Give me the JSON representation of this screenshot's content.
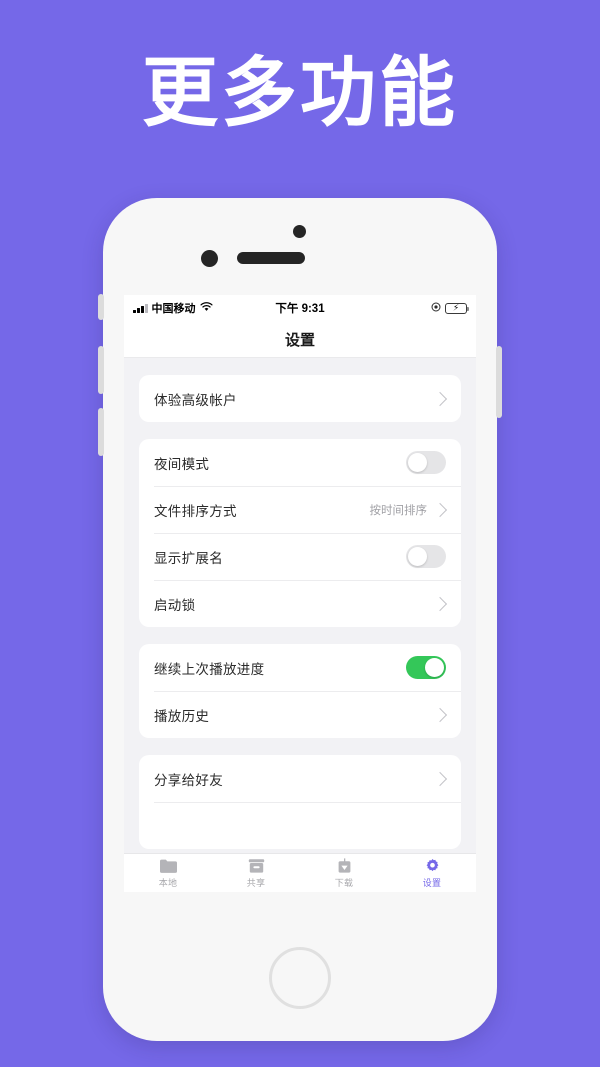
{
  "poster": {
    "headline": "更多功能",
    "background_color": "#7568e8",
    "accent_color": "#7568e8"
  },
  "phone": {
    "status_bar": {
      "carrier": "中国移动",
      "signal_icon": "signal-bars-icon",
      "wifi_icon": "wifi-icon",
      "time": "下午 9:31",
      "location_icon": "location-icon",
      "battery_icon": "battery-charging-icon",
      "battery_color": "#34c759"
    },
    "navbar": {
      "title": "设置"
    },
    "groups": [
      {
        "rows": [
          {
            "label": "体验高级帐户",
            "type": "link",
            "value": "",
            "accessory": "chevron-right-icon"
          }
        ]
      },
      {
        "rows": [
          {
            "label": "夜间模式",
            "type": "toggle",
            "value": "off",
            "accessory": "toggle-switch"
          },
          {
            "label": "文件排序方式",
            "type": "link",
            "value": "按时间排序",
            "accessory": "chevron-right-icon"
          },
          {
            "label": "显示扩展名",
            "type": "toggle",
            "value": "off",
            "accessory": "toggle-switch"
          },
          {
            "label": "启动锁",
            "type": "link",
            "value": "",
            "accessory": "chevron-right-icon"
          }
        ]
      },
      {
        "rows": [
          {
            "label": "继续上次播放进度",
            "type": "toggle",
            "value": "on",
            "accessory": "toggle-switch"
          },
          {
            "label": "播放历史",
            "type": "link",
            "value": "",
            "accessory": "chevron-right-icon"
          }
        ]
      },
      {
        "rows": [
          {
            "label": "分享给好友",
            "type": "link",
            "value": "",
            "accessory": "chevron-right-icon"
          }
        ]
      }
    ],
    "tabbar": {
      "active_color": "#7568e8",
      "inactive_color": "#a8a8ac",
      "tabs": [
        {
          "label": "本地",
          "icon": "folder-icon",
          "active": false
        },
        {
          "label": "共享",
          "icon": "archive-box-icon",
          "active": false
        },
        {
          "label": "下载",
          "icon": "download-icon",
          "active": false
        },
        {
          "label": "设置",
          "icon": "gear-icon",
          "active": true
        }
      ]
    }
  }
}
